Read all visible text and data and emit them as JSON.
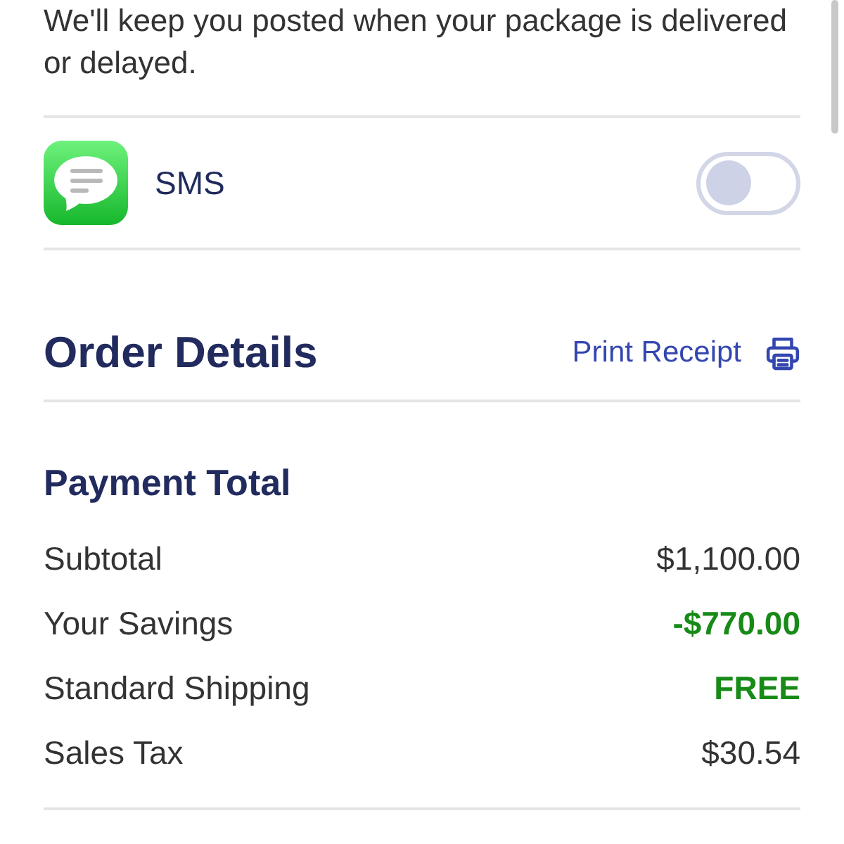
{
  "notice": {
    "text": "We'll keep you posted when your package is delivered or delayed."
  },
  "channels": [
    {
      "label": "SMS",
      "on": false
    }
  ],
  "order_details": {
    "title": "Order Details",
    "print_link": "Print Receipt"
  },
  "payment_total": {
    "title": "Payment Total",
    "rows": [
      {
        "label": "Subtotal",
        "value": "$1,100.00",
        "highlighted": false
      },
      {
        "label": "Your Savings",
        "value": "-$770.00",
        "highlighted": true
      },
      {
        "label": "Standard Shipping",
        "value": "FREE",
        "highlighted": true
      },
      {
        "label": "Sales Tax",
        "value": "$30.54",
        "highlighted": false
      }
    ]
  }
}
